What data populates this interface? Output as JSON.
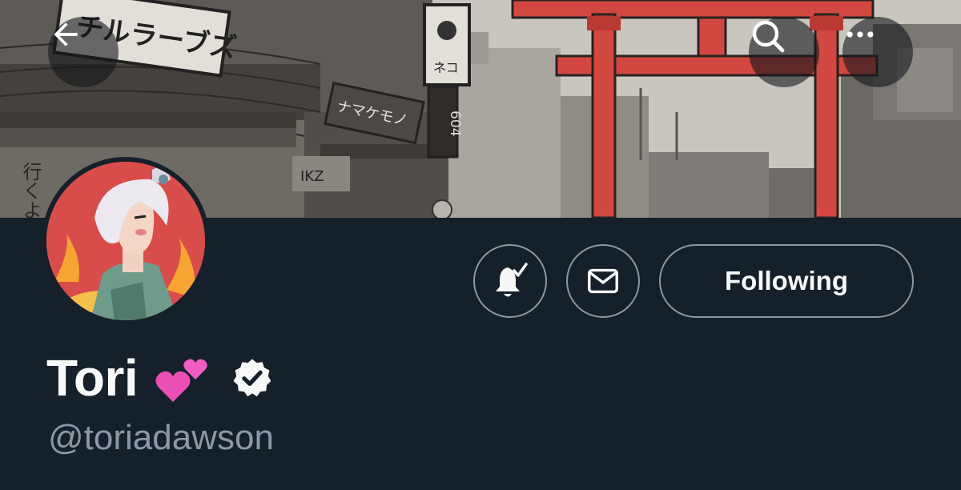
{
  "banner": {
    "signs": {
      "shop_sign": "チルラーブズ",
      "cat_sign": "ネコ",
      "number_sign": "604",
      "namakemono_sign": "ナマケモノ",
      "ikz_sign": "IKZ",
      "vertical_sign": "行くよ"
    }
  },
  "header": {
    "back_icon": "arrow-left-icon",
    "search_icon": "search-icon",
    "more_icon": "more-horizontal-icon"
  },
  "profile": {
    "display_name": "Tori",
    "name_emoji": "💕",
    "verified_icon": "verified-badge-icon",
    "handle": "@toriadawson"
  },
  "actions": {
    "notifications_icon": "bell-check-icon",
    "message_icon": "envelope-icon",
    "following_label": "Following"
  },
  "colors": {
    "background": "#15202b",
    "text_primary": "#f7f9f9",
    "text_secondary": "#8b98a5",
    "torii_red": "#d2473f",
    "avatar_bg": "#d84c4a"
  }
}
